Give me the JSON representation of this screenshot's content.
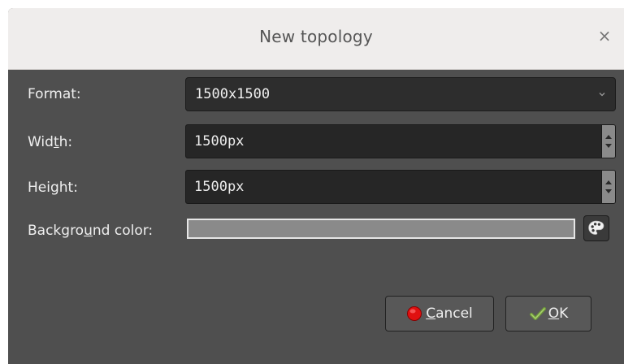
{
  "dialog": {
    "title": "New topology",
    "close_glyph": "×",
    "colors": {
      "background": "#4f4f4f",
      "titlebar": "#efedec",
      "field": "#262626"
    }
  },
  "form": {
    "format": {
      "label_pre": "Format:",
      "label_ul": "",
      "label_post": "",
      "value": "1500x1500"
    },
    "width": {
      "label_pre": "Wid",
      "label_ul": "t",
      "label_post": "h:",
      "value": "1500px"
    },
    "height": {
      "label_pre": "Height:",
      "label_ul": "",
      "label_post": "",
      "value": "1500px"
    },
    "background": {
      "label_pre": "Backgro",
      "label_ul": "u",
      "label_post": "nd color:",
      "color": "#8a8a8a"
    }
  },
  "buttons": {
    "cancel": {
      "ul": "C",
      "rest": "ancel",
      "icon": "red-circle-icon"
    },
    "ok": {
      "ul": "O",
      "rest": "K",
      "icon": "green-check-icon"
    }
  }
}
